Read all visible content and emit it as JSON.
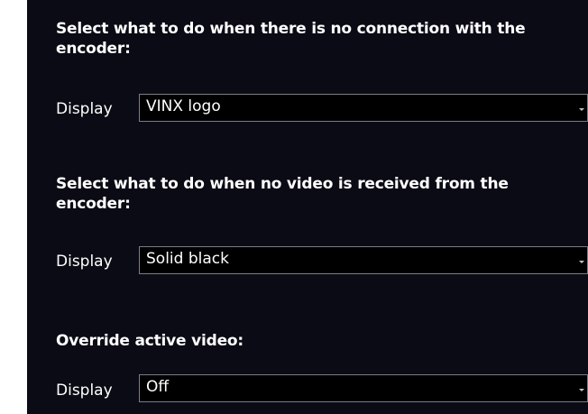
{
  "sections": [
    {
      "heading_line1": "Select what to do when there is no connection with the",
      "heading_line2": "encoder:",
      "label": "Display",
      "value": "VINX logo"
    },
    {
      "heading_line1": "Select what to do when no video is received from the",
      "heading_line2": "encoder:",
      "label": "Display",
      "value": "Solid black"
    },
    {
      "heading_line1": "Override active video:",
      "label": "Display",
      "value": "Off"
    }
  ],
  "icons": {
    "dropdown": "chevron-down-icon"
  }
}
